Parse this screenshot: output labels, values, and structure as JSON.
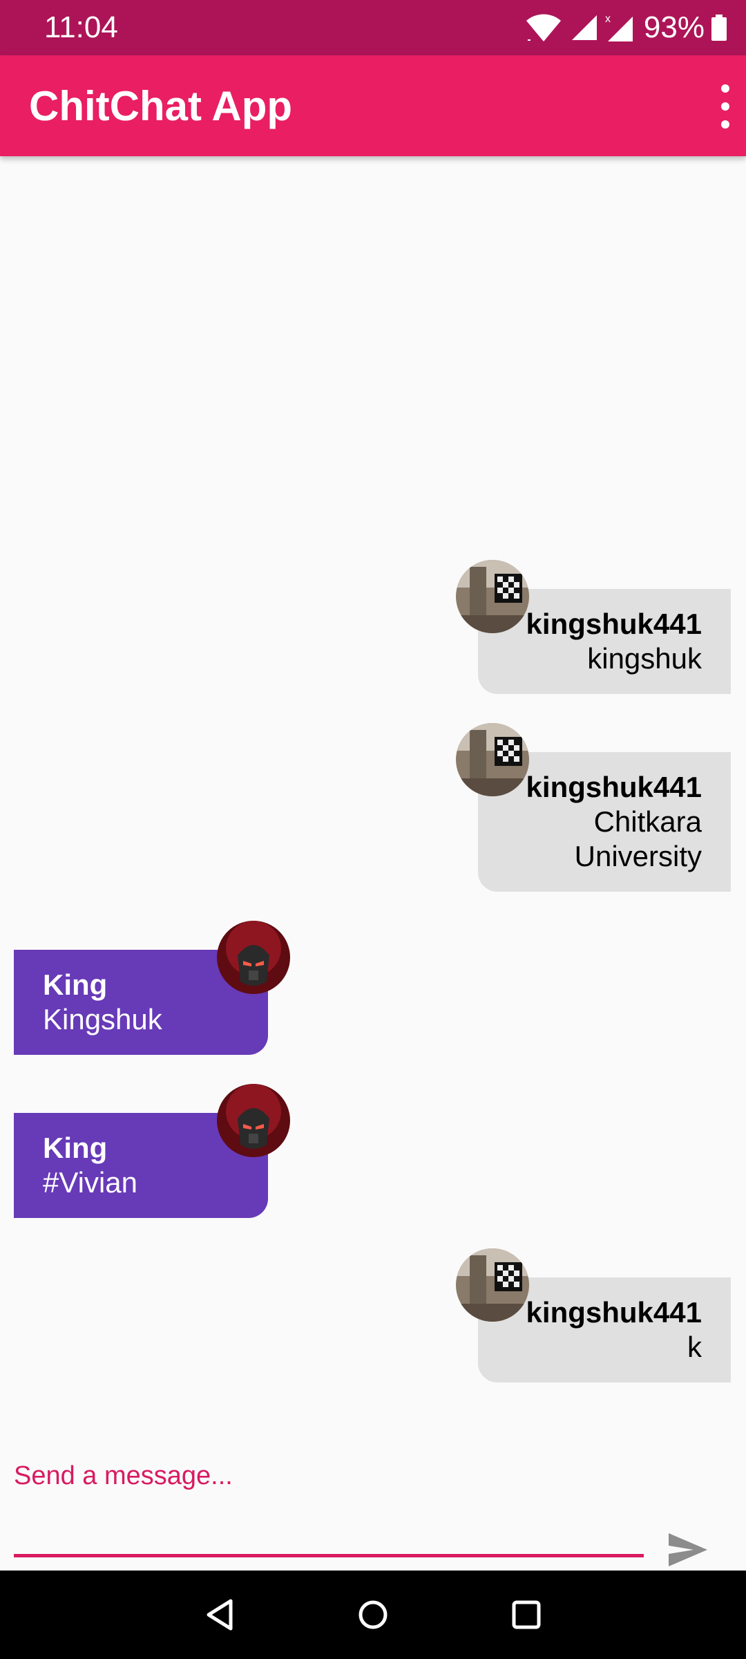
{
  "status_bar": {
    "time": "11:04",
    "battery": "93%",
    "icons": [
      "wifi-icon",
      "signal-icon",
      "signal-no-service-icon",
      "battery-icon"
    ]
  },
  "app_bar": {
    "title": "ChitChat App",
    "menu_icon": "more-vert-icon"
  },
  "messages": [
    {
      "side": "right",
      "user": "kingshuk441",
      "text_lines": [
        "kingshuk"
      ]
    },
    {
      "side": "right",
      "user": "kingshuk441",
      "text_lines": [
        "Chitkara",
        "University"
      ]
    },
    {
      "side": "left",
      "user": "King",
      "text_lines": [
        "Kingshuk"
      ]
    },
    {
      "side": "left",
      "user": "King",
      "text_lines": [
        "#Vivian"
      ]
    },
    {
      "side": "right",
      "user": "kingshuk441",
      "text_lines": [
        "k"
      ]
    }
  ],
  "composer": {
    "placeholder": "Send a message...",
    "send_icon": "send-icon"
  },
  "colors": {
    "status_bar": "#ad1457",
    "app_bar": "#e91e63",
    "accent": "#d81b60",
    "received_bubble": "#673ab7",
    "sent_bubble": "#e0e0e0"
  },
  "nav_bar": {
    "icons": [
      "back-icon",
      "home-icon",
      "recents-icon"
    ]
  }
}
